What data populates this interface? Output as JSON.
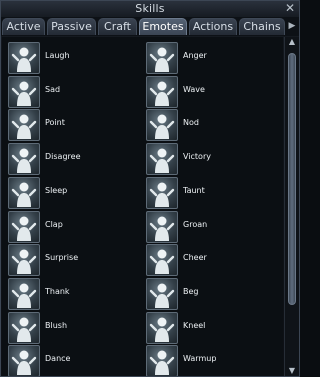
{
  "window": {
    "title": "Skills",
    "close_glyph": "✕"
  },
  "tabs": [
    {
      "label": "Active",
      "active": false
    },
    {
      "label": "Passive",
      "active": false
    },
    {
      "label": "Craft",
      "active": false
    },
    {
      "label": "Emotes",
      "active": true
    },
    {
      "label": "Actions",
      "active": false
    },
    {
      "label": "Chains",
      "active": false
    }
  ],
  "tab_scroll_glyph": "▶",
  "skills": [
    {
      "label": "Laugh",
      "icon": "laugh-emote-icon"
    },
    {
      "label": "Anger",
      "icon": "anger-emote-icon"
    },
    {
      "label": "Sad",
      "icon": "sad-emote-icon"
    },
    {
      "label": "Wave",
      "icon": "wave-emote-icon"
    },
    {
      "label": "Point",
      "icon": "point-emote-icon"
    },
    {
      "label": "Nod",
      "icon": "nod-emote-icon"
    },
    {
      "label": "Disagree",
      "icon": "disagree-emote-icon"
    },
    {
      "label": "Victory",
      "icon": "victory-emote-icon"
    },
    {
      "label": "Sleep",
      "icon": "sleep-emote-icon"
    },
    {
      "label": "Taunt",
      "icon": "taunt-emote-icon"
    },
    {
      "label": "Clap",
      "icon": "clap-emote-icon"
    },
    {
      "label": "Groan",
      "icon": "groan-emote-icon"
    },
    {
      "label": "Surprise",
      "icon": "surprise-emote-icon"
    },
    {
      "label": "Cheer",
      "icon": "cheer-emote-icon"
    },
    {
      "label": "Thank",
      "icon": "thank-emote-icon"
    },
    {
      "label": "Beg",
      "icon": "beg-emote-icon"
    },
    {
      "label": "Blush",
      "icon": "blush-emote-icon"
    },
    {
      "label": "Kneel",
      "icon": "kneel-emote-icon"
    },
    {
      "label": "Dance",
      "icon": "dance-emote-icon"
    },
    {
      "label": "Warmup",
      "icon": "warmup-emote-icon"
    }
  ],
  "scrollbar": {
    "up_glyph": "▲",
    "down_glyph": "▼"
  }
}
